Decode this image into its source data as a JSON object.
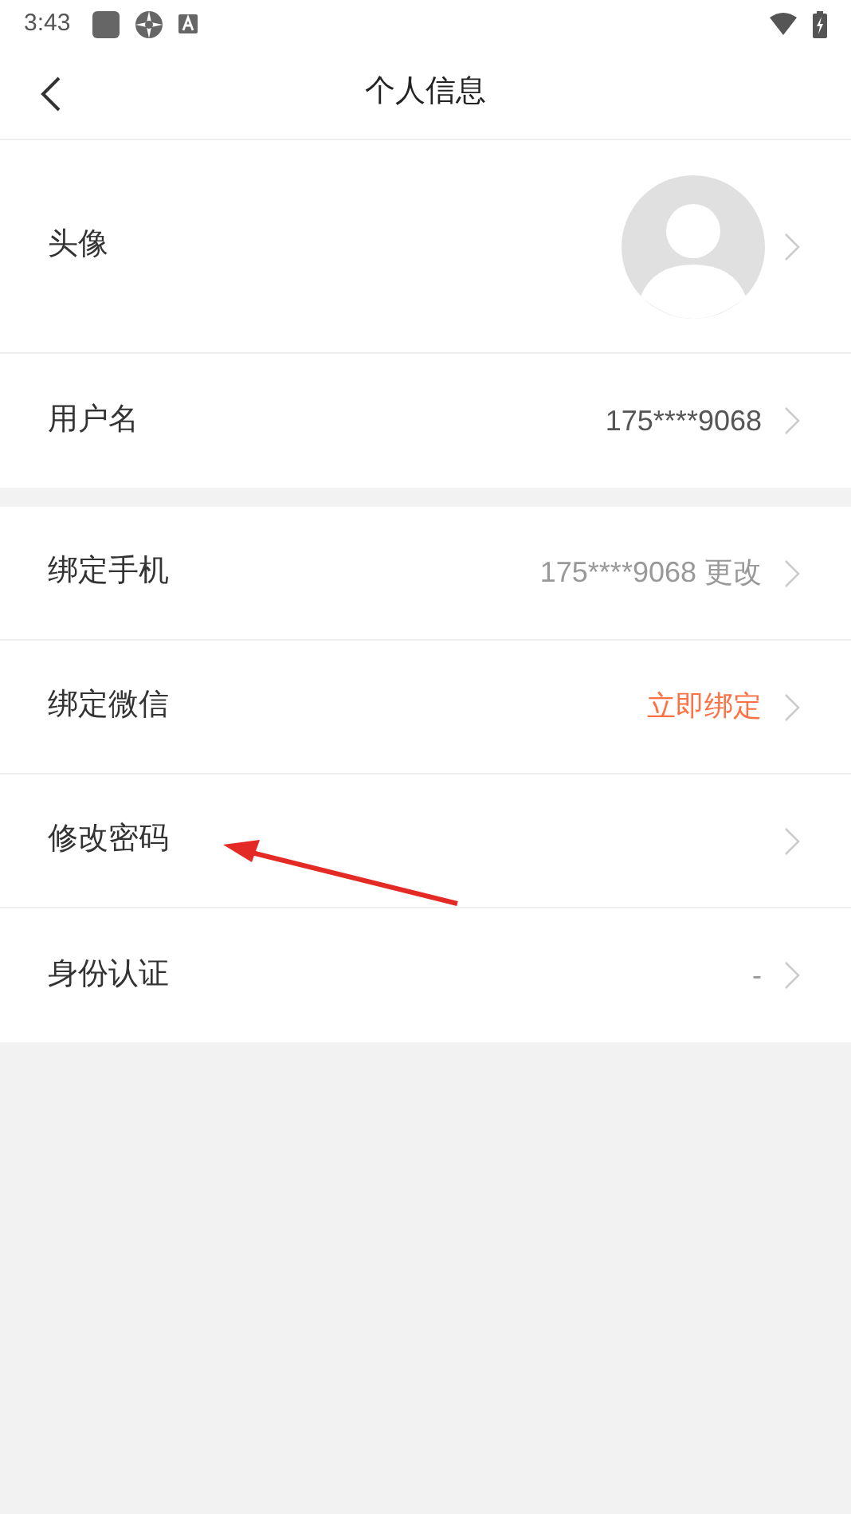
{
  "status_bar": {
    "time": "3:43"
  },
  "header": {
    "title": "个人信息"
  },
  "sections": [
    {
      "rows": [
        {
          "kind": "avatar",
          "label": "头像"
        },
        {
          "kind": "text",
          "label": "用户名",
          "value": "175****9068",
          "color": "#555555"
        }
      ]
    },
    {
      "rows": [
        {
          "kind": "text",
          "label": "绑定手机",
          "value": "175****9068 更改",
          "color": "#999999"
        },
        {
          "kind": "text",
          "label": "绑定微信",
          "value": "立即绑定",
          "color": "#ff7043"
        },
        {
          "kind": "plain",
          "label": "修改密码"
        },
        {
          "kind": "text",
          "label": "身份认证",
          "value": "-",
          "color": "#999999"
        }
      ]
    }
  ]
}
